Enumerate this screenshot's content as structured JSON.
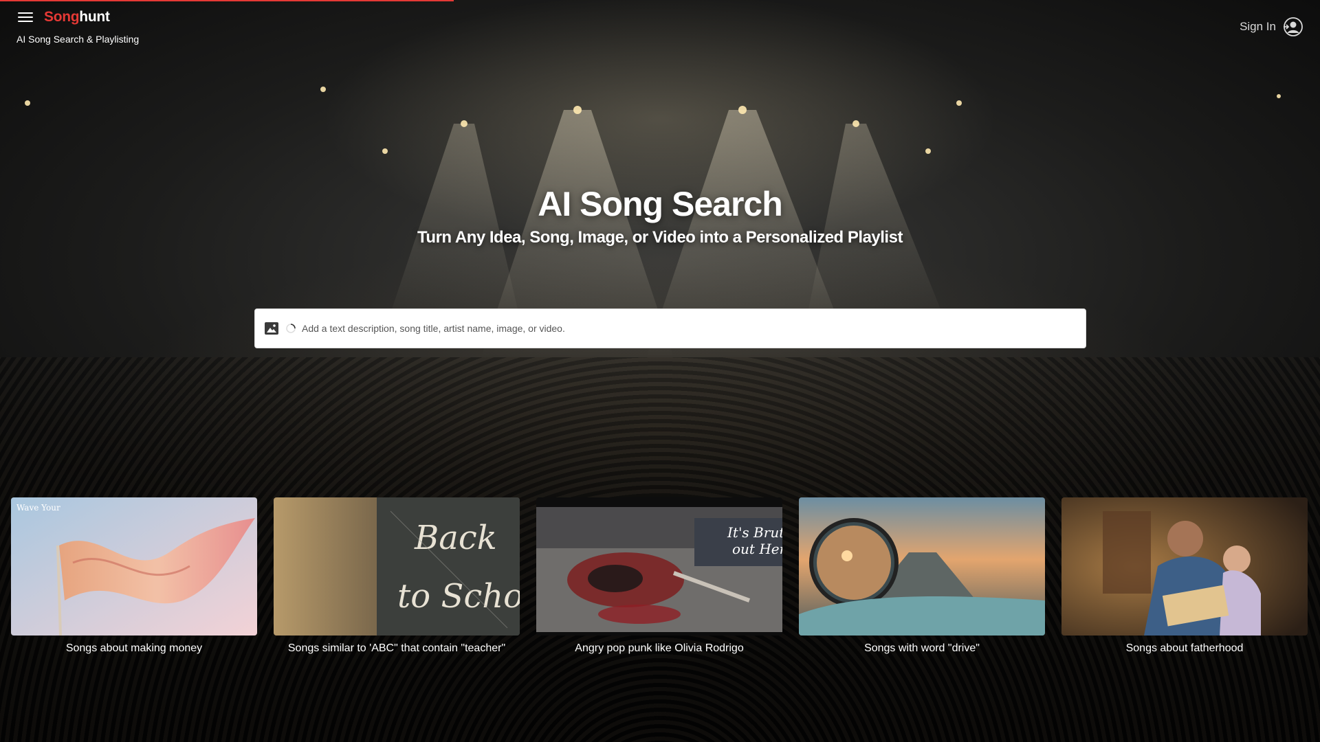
{
  "header": {
    "logo_part1": "Song",
    "logo_part2": "hunt",
    "tagline": "AI Song Search & Playlisting",
    "signin_label": "Sign In",
    "menu_icon": "hamburger-menu-icon",
    "user_icon": "user-circle-icon"
  },
  "progress": {
    "fraction": 0.344
  },
  "hero": {
    "title": "AI Song Search",
    "subtitle": "Turn Any Idea, Song, Image, or Video into a Personalized Playlist"
  },
  "search": {
    "placeholder": "Add a text description, song title, artist name, image, or video.",
    "value": "",
    "image_icon": "image-upload-icon"
  },
  "cards": [
    {
      "label": "Songs about making money",
      "thumb_caption": "Wave Your",
      "image": "waving-flag"
    },
    {
      "label": "Songs similar to 'ABC\" that contain \"teacher\"",
      "image": "back-to-school-chalkboard"
    },
    {
      "label": "Angry pop punk like Olivia Rodrigo",
      "image": "smashed-guitar-street"
    },
    {
      "label": "Songs with word \"drive\"",
      "image": "car-side-mirror-road"
    },
    {
      "label": "Songs about fatherhood",
      "image": "father-reading-to-child"
    }
  ],
  "colors": {
    "brand_red": "#e53935",
    "text_white": "#ffffff"
  }
}
